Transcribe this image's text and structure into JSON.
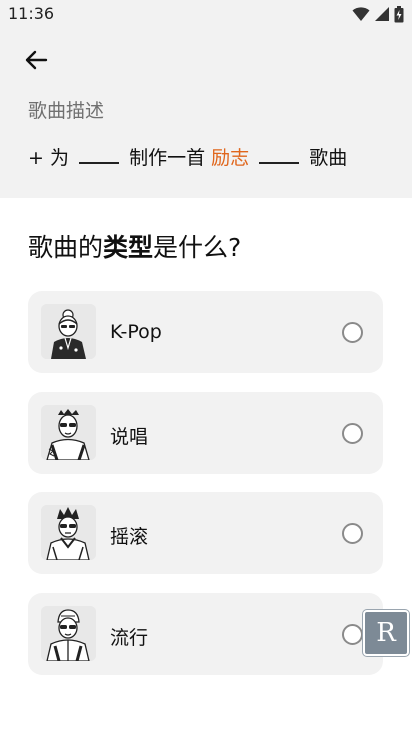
{
  "status": {
    "time": "11:36"
  },
  "header": {
    "description_title": "歌曲描述"
  },
  "prompt": {
    "prefix": "+ 为",
    "middle": "制作一首",
    "accent_word": "励志",
    "suffix": "歌曲"
  },
  "question": {
    "before": "歌曲的",
    "bold": "类型",
    "after": "是什么?"
  },
  "options": [
    {
      "label": "K-Pop",
      "icon": "kpop-avatar-icon"
    },
    {
      "label": "说唱",
      "icon": "rap-avatar-icon"
    },
    {
      "label": "摇滚",
      "icon": "rock-avatar-icon"
    },
    {
      "label": "流行",
      "icon": "pop-avatar-icon"
    }
  ],
  "overlay_badge": {
    "text": "R"
  },
  "colors": {
    "accent": "#e0661c",
    "card": "#f2f2f2",
    "header_bg": "#f2f2f2"
  }
}
